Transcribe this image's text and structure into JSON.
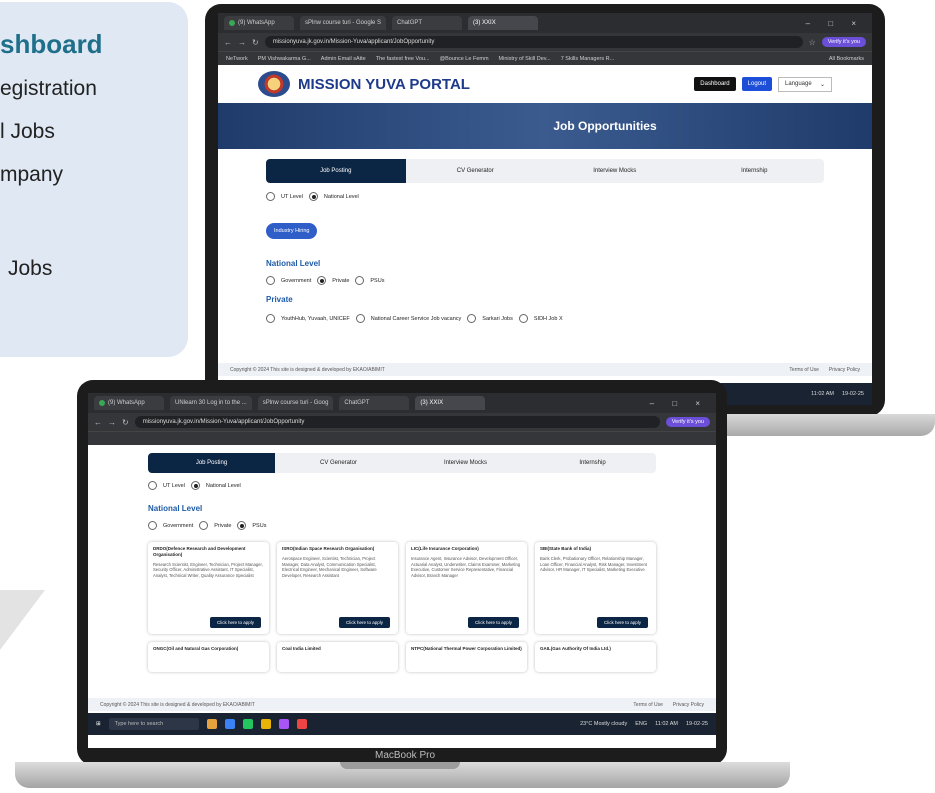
{
  "side_panel": {
    "title": "shboard",
    "items": [
      "egistration",
      "l Jobs",
      "mpany",
      "Jobs"
    ]
  },
  "back_screen": {
    "browser": {
      "tabs": [
        "(9) WhatsApp",
        "sPlnw course turi - Google S",
        "ChatGPT",
        "(3) XXIX"
      ],
      "url": "missionyuva.jk.gov.in/Mission-Yuva/applicant/JobOpportunity",
      "verify_label": "Verify it's you",
      "bookmarks": [
        "NeTwork",
        "PM Vishwakarma G...",
        "Admin Email sAtte",
        "The fastest free Vou...",
        "@Bounce Le Femm",
        "Ministry of Skill Dev...",
        "7 Skills Managers R..."
      ],
      "all_bookmarks": "All Bookmarks"
    },
    "portal": {
      "title": "MISSION YUVA PORTAL",
      "dashboard_label": "Dashboard",
      "logout_label": "Logout",
      "language_label": "Language",
      "banner_title": "Job Opportunities",
      "tabs": [
        "Job Posting",
        "CV Generator",
        "Interview Mocks",
        "Internship"
      ],
      "level_options": [
        "UT Level",
        "National Level"
      ],
      "industry_pill": "Industry Hiring",
      "national_title": "National Level",
      "sector_options": [
        "Government",
        "Private",
        "PSUs"
      ],
      "private_title": "Private",
      "private_options": [
        "YouthHub, Yuvaah, UNICEF",
        "National Career Service Job vacancy",
        "Sarkari Jobs",
        "SIDH Job X"
      ],
      "footer_left": "Copyright © 2024 This site is designed & developed by EKAO/ABIMIT",
      "footer_right": [
        "Terms of Use",
        "Privacy Policy"
      ],
      "clock": "11:02 AM",
      "date": "19-02-25"
    }
  },
  "front_screen": {
    "browser": {
      "tabs": [
        "(9) WhatsApp",
        "UNlearn 30 Log in to the ...",
        "sPlnw course turi - Goog",
        "ChatGPT",
        "(3) XXIX"
      ],
      "url": "missionyuva.jk.gov.in/Mission-Yuva/applicant/JobOpportunity",
      "verify_label": "Verify it's you"
    },
    "portal": {
      "tabs": [
        "Job Posting",
        "CV Generator",
        "Interview Mocks",
        "Internship"
      ],
      "level_options": [
        "UT Level",
        "National Level"
      ],
      "national_title": "National Level",
      "sector_options": [
        "Government",
        "Private",
        "PSUs"
      ],
      "cards": [
        {
          "title": "DRDO(Defence Research and Development Organisation)",
          "body": "Research Scientist, Engineer, Technician, Project Manager, Security Officer, Administrative Assistant, IT Specialist, Analyst, Technical Writer, Quality Assurance Specialist"
        },
        {
          "title": "ISRO(Indian Space Research Organisation)",
          "body": "Aerospace Engineer, Scientist, Technician, Project Manager, Data Analyst, Communication Specialist, Electrical Engineer, Mechanical Engineer, Software Developer, Research Assistant"
        },
        {
          "title": "LIC(Life Insurance Corporation)",
          "body": "Insurance Agent, Insurance Advisor, Development Officer, Actuarial Analyst, Underwriter, Claims Examiner, Marketing Executive, Customer Service Representative, Financial Advisor, Branch Manager"
        },
        {
          "title": "SBI(State Bank of India)",
          "body": "Bank Clerk, Probationary Officer, Relationship Manager, Loan Officer, Financial Analyst, Risk Manager, Investment Advisor, HR Manager, IT Specialist, Marketing Executive"
        }
      ],
      "apply_label": "Click here to apply",
      "next_cards": [
        "ONGC(Oil and Natural Gas Corporation)",
        "Coal India Limited",
        "NTPC(National Thermal Power Corporation Limited)",
        "GAIL(Gas Authority Of India Ltd.)"
      ],
      "footer_left": "Copyright © 2024 This site is designed & developed by EKAO/ABIMIT",
      "footer_right": [
        "Terms of Use",
        "Privacy Policy"
      ]
    },
    "taskbar": {
      "search_placeholder": "Type here to search",
      "weather": "23°C Mostly cloudy",
      "lang": "ENG",
      "clock": "11:02 AM",
      "date": "19-02-25"
    }
  },
  "device_label": "MacBook Pro"
}
